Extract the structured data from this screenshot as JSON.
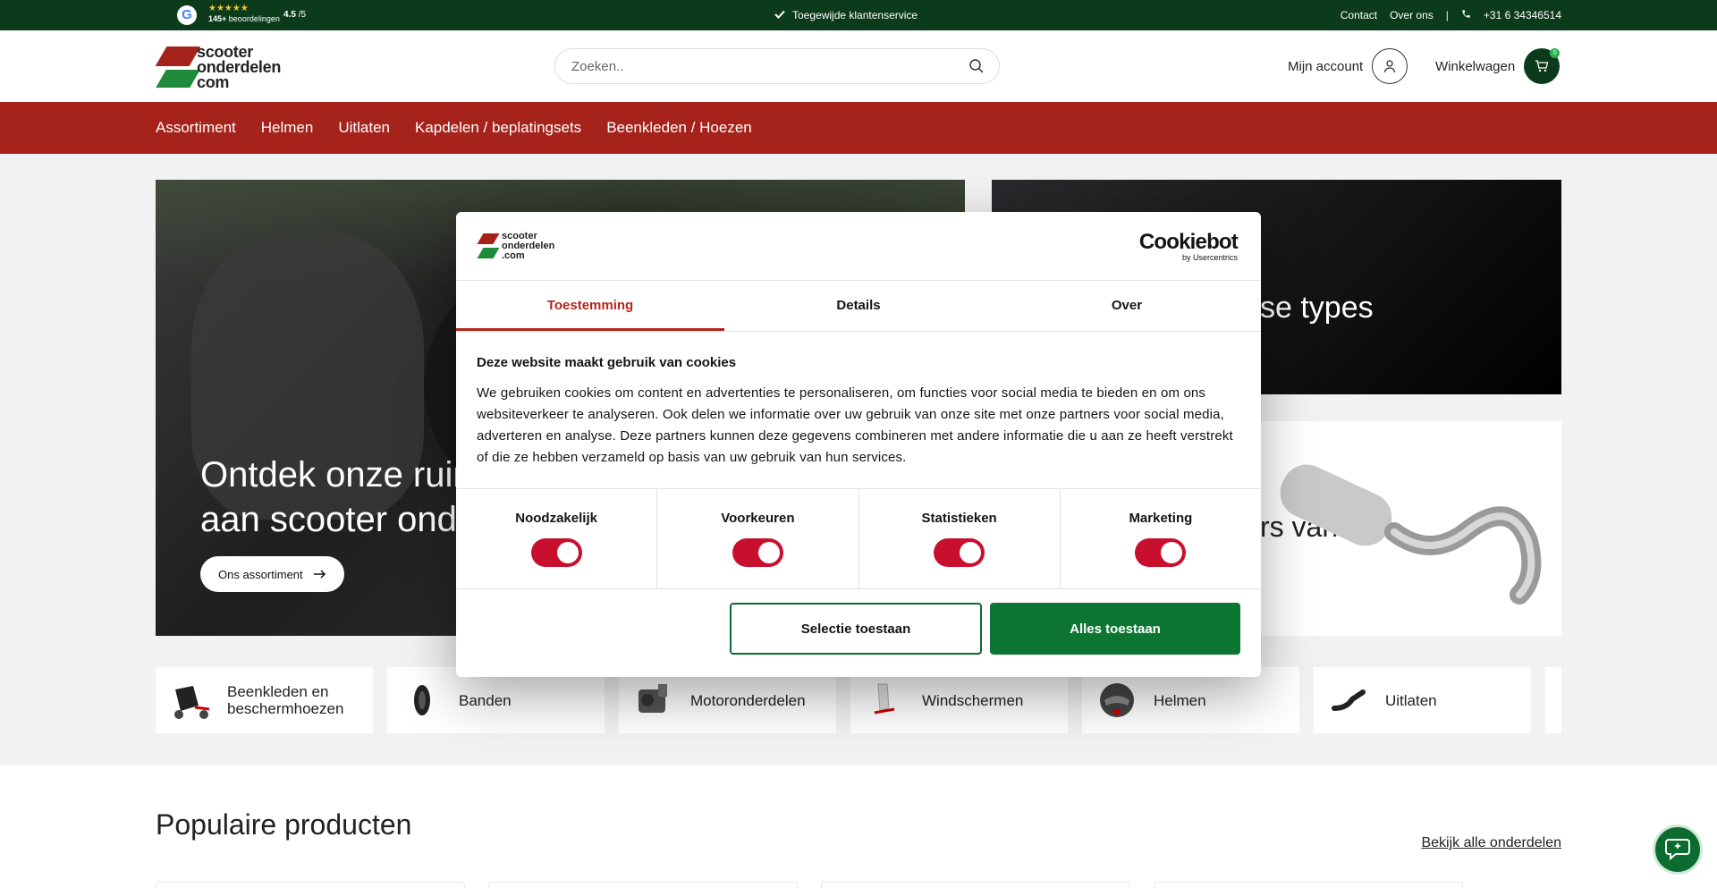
{
  "topbar": {
    "stars": "★★★★★",
    "reviews_count": "145+",
    "reviews_label": "beoordelingen",
    "score": "4.5",
    "score_max": "/5",
    "service": "Toegewijde klantenservice",
    "links": [
      "Contact",
      "Over ons"
    ],
    "separator": "|",
    "phone": "+31 6 34346514"
  },
  "header": {
    "logo_line1": "scooter",
    "logo_line2": "onderdelen",
    "logo_line3": "com",
    "search_placeholder": "Zoeken..",
    "account_label": "Mijn account",
    "cart_label": "Winkelwagen",
    "cart_count": "0"
  },
  "nav": {
    "items": [
      "Assortiment",
      "Helmen",
      "Uitlaten",
      "Kapdelen / beplatingsets",
      "Beenkleden / Hoezen"
    ]
  },
  "hero": {
    "title_line1": "Ontdek onze ruim",
    "title_line2": "aan scooter onde",
    "button_label": "Ons assortiment",
    "right_top_text": "se types",
    "right_bottom_text": "rs van"
  },
  "categories": [
    {
      "label": "Beenkleden en beschermhoezen",
      "icon": "legcover-icon"
    },
    {
      "label": "Banden",
      "icon": "tire-icon"
    },
    {
      "label": "Motoronderdelen",
      "icon": "engine-icon"
    },
    {
      "label": "Windschermen",
      "icon": "windshield-icon"
    },
    {
      "label": "Helmen",
      "icon": "helmet-icon"
    },
    {
      "label": "Uitlaten",
      "icon": "exhaust-icon"
    }
  ],
  "popular": {
    "title": "Populaire producten",
    "view_all": "Bekijk alle onderdelen"
  },
  "cookie_dialog": {
    "logo_line1": "scooter",
    "logo_line2": "onderdelen",
    "logo_line3": ".com",
    "brand": "Cookiebot",
    "brand_sub": "by Usercentrics",
    "tabs": [
      "Toestemming",
      "Details",
      "Over"
    ],
    "heading": "Deze website maakt gebruik van cookies",
    "body": "We gebruiken cookies om content en advertenties te personaliseren, om functies voor social media te bieden en om ons websiteverkeer te analyseren. Ook delen we informatie over uw gebruik van onze site met onze partners voor social media, adverteren en analyse. Deze partners kunnen deze gegevens combineren met andere informatie die u aan ze heeft verstrekt of die ze hebben verzameld op basis van uw gebruik van hun services.",
    "consents": [
      {
        "label": "Noodzakelijk",
        "checked": true
      },
      {
        "label": "Voorkeuren",
        "checked": true
      },
      {
        "label": "Statistieken",
        "checked": true
      },
      {
        "label": "Marketing",
        "checked": true
      }
    ],
    "btn_selection": "Selectie toestaan",
    "btn_all": "Alles toestaan"
  },
  "colors": {
    "dark_green": "#0c3b1c",
    "nav_red": "#a6231c",
    "accent_red": "#b3261e",
    "toggle_red": "#c8102e",
    "button_green": "#0c7531"
  }
}
